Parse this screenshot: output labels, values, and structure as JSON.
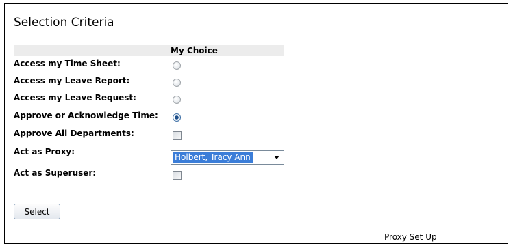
{
  "panel": {
    "title": "Selection Criteria"
  },
  "table": {
    "column_header": "My Choice",
    "rows": [
      {
        "label": "Access my Time Sheet:",
        "control": "radio",
        "checked": false
      },
      {
        "label": "Access my Leave Report:",
        "control": "radio",
        "checked": false
      },
      {
        "label": "Access my Leave Request:",
        "control": "radio",
        "checked": false
      },
      {
        "label": "Approve or Acknowledge Time:",
        "control": "radio",
        "checked": true
      },
      {
        "label": "Approve All Departments:",
        "control": "checkbox",
        "checked": false
      },
      {
        "label": "Act as Proxy:",
        "control": "select",
        "selected_value": "Holbert, Tracy Ann"
      },
      {
        "label": "Act as Superuser:",
        "control": "checkbox",
        "checked": false
      }
    ]
  },
  "actions": {
    "select_button_label": "Select",
    "proxy_setup_link": "Proxy Set Up"
  },
  "colors": {
    "header_band": "#ececec",
    "selection_highlight": "#3b7dd8",
    "text": "#000000"
  }
}
